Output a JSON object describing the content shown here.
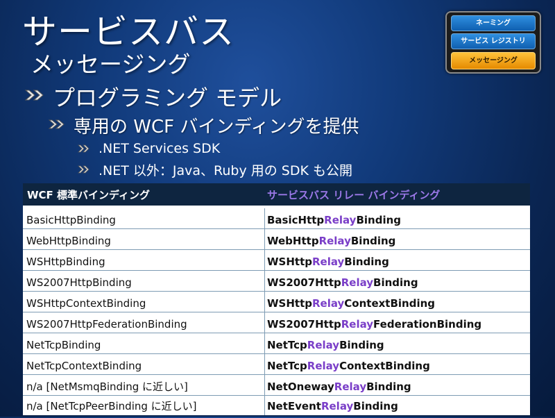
{
  "title": "サービスバス",
  "subtitle": "メッセージング",
  "nav": {
    "items": [
      {
        "label": "ネーミング",
        "active": false
      },
      {
        "label": "サービス レジストリ",
        "active": false
      },
      {
        "label": "メッセージング",
        "active": true
      }
    ],
    "colors": {
      "blue": "#1f7fd6",
      "orange": "#f5a623"
    }
  },
  "bullets": {
    "level1": "プログラミング モデル",
    "level2": "専用の WCF バインディングを提供",
    "level3": [
      ".NET Services SDK",
      ".NET 以外：Java、Ruby 用の SDK も公開"
    ]
  },
  "table": {
    "headers": [
      "WCF 標準バインディング",
      "サービスバス リレー バインディング"
    ],
    "rows": [
      {
        "standard": "BasicHttpBinding",
        "relay_prefix": "BasicHttp",
        "relay_mid": "Relay",
        "relay_suffix": "Binding"
      },
      {
        "standard": "WebHttpBinding",
        "relay_prefix": "WebHttp",
        "relay_mid": "Relay",
        "relay_suffix": "Binding"
      },
      {
        "standard": "WSHttpBinding",
        "relay_prefix": "WSHttp",
        "relay_mid": "Relay",
        "relay_suffix": "Binding"
      },
      {
        "standard": "WS2007HttpBinding",
        "relay_prefix": "WS2007Http",
        "relay_mid": "Relay",
        "relay_suffix": "Binding"
      },
      {
        "standard": "WSHttpContextBinding",
        "relay_prefix": "WSHttp",
        "relay_mid": "Relay",
        "relay_suffix": "ContextBinding"
      },
      {
        "standard": "WS2007HttpFederationBinding",
        "relay_prefix": "WS2007Http",
        "relay_mid": "Relay",
        "relay_suffix": "FederationBinding"
      },
      {
        "standard": "NetTcpBinding",
        "relay_prefix": "NetTcp",
        "relay_mid": "Relay",
        "relay_suffix": "Binding"
      },
      {
        "standard": "NetTcpContextBinding",
        "relay_prefix": "NetTcp",
        "relay_mid": "Relay",
        "relay_suffix": "ContextBinding"
      },
      {
        "standard": "n/a  [NetMsmqBinding に近しい]",
        "relay_prefix": "NetOneway",
        "relay_mid": "Relay",
        "relay_suffix": "Binding"
      },
      {
        "standard": "n/a  [NetTcpPeerBinding に近しい]",
        "relay_prefix": "NetEvent",
        "relay_mid": "Relay",
        "relay_suffix": "Binding"
      }
    ],
    "colors": {
      "header_bg": "#0e2540",
      "relay_header": "#9b78e8",
      "relay_text": "#7a3ec8"
    }
  }
}
